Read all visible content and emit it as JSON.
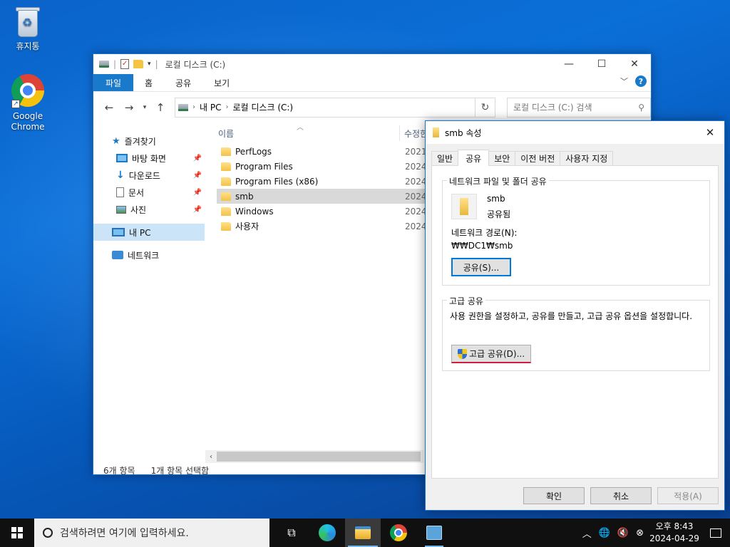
{
  "desktop": {
    "recycle_bin_label": "휴지통",
    "chrome_label_1": "Google",
    "chrome_label_2": "Chrome"
  },
  "explorer": {
    "title": "로컬 디스크 (C:)",
    "ribbon_tabs": [
      "파일",
      "홈",
      "공유",
      "보기"
    ],
    "breadcrumb": [
      "내 PC",
      "로컬 디스크 (C:)"
    ],
    "search_placeholder": "로컬 디스크 (C:) 검색",
    "nav_pane": {
      "quick_access": "즐겨찾기",
      "items": [
        "바탕 화면",
        "다운로드",
        "문서",
        "사진"
      ],
      "this_pc": "내 PC",
      "network": "네트워크"
    },
    "columns": {
      "name": "이름",
      "modified": "수정한"
    },
    "files": [
      {
        "name": "PerfLogs",
        "date": "2021"
      },
      {
        "name": "Program Files",
        "date": "2024"
      },
      {
        "name": "Program Files (x86)",
        "date": "2024"
      },
      {
        "name": "smb",
        "date": "2024"
      },
      {
        "name": "Windows",
        "date": "2024"
      },
      {
        "name": "사용자",
        "date": "2024"
      }
    ],
    "status": {
      "item_count": "6개 항목",
      "selected_count": "1개 항목 선택함"
    }
  },
  "dialog": {
    "title": "smb 속성",
    "tabs": [
      "일반",
      "공유",
      "보안",
      "이전 버전",
      "사용자 지정"
    ],
    "active_tab_index": 1,
    "network_share": {
      "legend": "네트워크 파일 및 폴더 공유",
      "share_name": "smb",
      "share_status": "공유됨",
      "path_label": "네트워크 경로(N):",
      "path_value": "₩₩DC1₩smb",
      "share_button": "공유(S)..."
    },
    "advanced_share": {
      "legend": "고급 공유",
      "description": "사용 권한을 설정하고, 공유를 만들고, 고급 공유 옵션을 설정합니다.",
      "button": "고급 공유(D)..."
    },
    "buttons": {
      "ok": "확인",
      "cancel": "취소",
      "apply": "적용(A)"
    }
  },
  "taskbar": {
    "search_placeholder": "검색하려면 여기에 입력하세요.",
    "time": "오후 8:43",
    "date": "2024-04-29"
  }
}
